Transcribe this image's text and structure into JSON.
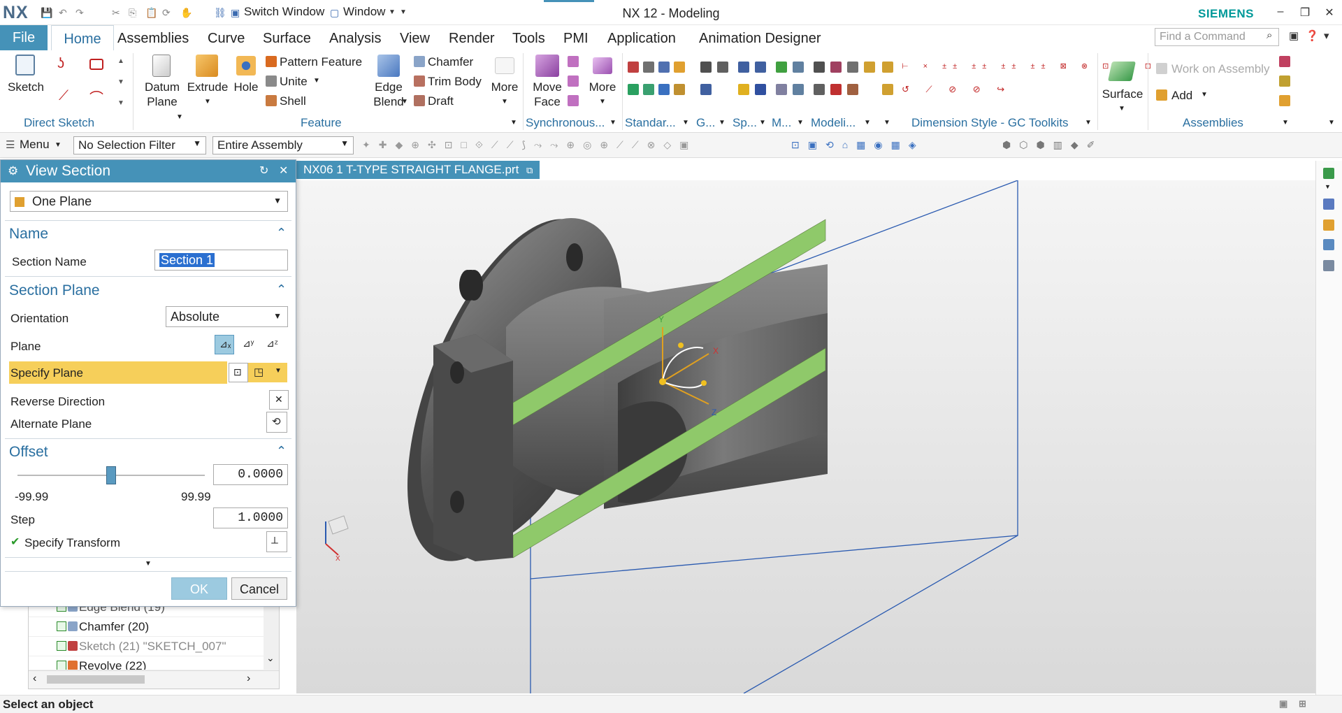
{
  "titlebar": {
    "app_logo": "NX",
    "quick_access": {
      "switch_window": "Switch Window",
      "window": "Window"
    },
    "title": "NX 12 - Modeling",
    "brand": "SIEMENS"
  },
  "menubar": {
    "file": "File",
    "tabs": [
      "Home",
      "Assemblies",
      "Curve",
      "Surface",
      "Analysis",
      "View",
      "Render",
      "Tools",
      "PMI",
      "Application",
      "Animation Designer"
    ],
    "active_tab": "Home",
    "find_placeholder": "Find a Command"
  },
  "ribbon": {
    "sketch": "Sketch",
    "direct_sketch": "Direct Sketch",
    "datum_plane": "Datum\nPlane",
    "extrude": "Extrude",
    "hole": "Hole",
    "pattern_feature": "Pattern Feature",
    "unite": "Unite",
    "shell": "Shell",
    "edge_blend": "Edge\nBlend",
    "chamfer": "Chamfer",
    "trim_body": "Trim Body",
    "draft": "Draft",
    "more1": "More",
    "feature_group": "Feature",
    "move_face": "Move\nFace",
    "more2": "More",
    "synchronous_group": "Synchronous...",
    "standard_group": "Standar...",
    "g_group": "G...",
    "sp_group": "Sp...",
    "m_group": "M...",
    "modeling_group": "Modeli...",
    "dimension_group": "Dimension Style - GC Toolkits",
    "surface": "Surface",
    "work_on_assembly": "Work on Assembly",
    "add": "Add",
    "assemblies_group": "Assemblies"
  },
  "filterbar": {
    "menu": "Menu",
    "selection_filter": "No Selection Filter",
    "scope": "Entire Assembly"
  },
  "document_tab": "NX06 1 T-TYPE STRAIGHT FLANGE.prt",
  "dialog": {
    "title": "View Section",
    "type": "One Plane",
    "name_section": "Name",
    "section_name_label": "Section Name",
    "section_name_value": "Section 1",
    "section_plane": "Section Plane",
    "orientation_label": "Orientation",
    "orientation_value": "Absolute",
    "plane_label": "Plane",
    "specify_plane": "Specify Plane",
    "reverse_direction": "Reverse Direction",
    "alternate_plane": "Alternate Plane",
    "offset_section": "Offset",
    "offset_value": "0.0000",
    "offset_fraction": 0.5,
    "min": "-99.99",
    "max": "99.99",
    "step_label": "Step",
    "step_value": "1.0000",
    "specify_transform": "Specify Transform",
    "ok": "OK",
    "cancel": "Cancel"
  },
  "tree": {
    "items": [
      "Edge Blend (19)",
      "Chamfer (20)",
      "Sketch (21) \"SKETCH_007\"",
      "Revolve (22)"
    ]
  },
  "axes": {
    "x": "X",
    "y": "Y",
    "z": "Z"
  },
  "status": "Select an object",
  "colors": {
    "accent": "#4592b8",
    "section_face": "#8fc96a",
    "specify_highlight": "#f6cf5a"
  }
}
